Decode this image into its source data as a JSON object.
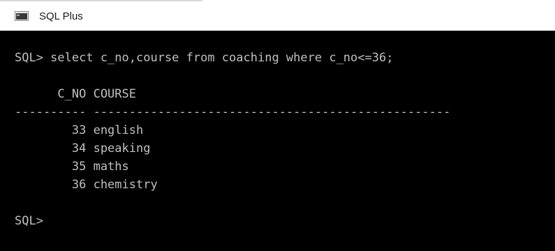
{
  "window": {
    "title": "SQL Plus",
    "icon": "console-window-icon"
  },
  "console": {
    "colors": {
      "background": "#000000",
      "text": "#c0c0c0"
    },
    "lines": [
      "SQL> select c_no,course from coaching where c_no<=36;",
      "",
      "      C_NO COURSE",
      "---------- --------------------------------------------------",
      "        33 english",
      "        34 speaking",
      "        35 maths",
      "        36 chemistry",
      "",
      "SQL> "
    ]
  }
}
